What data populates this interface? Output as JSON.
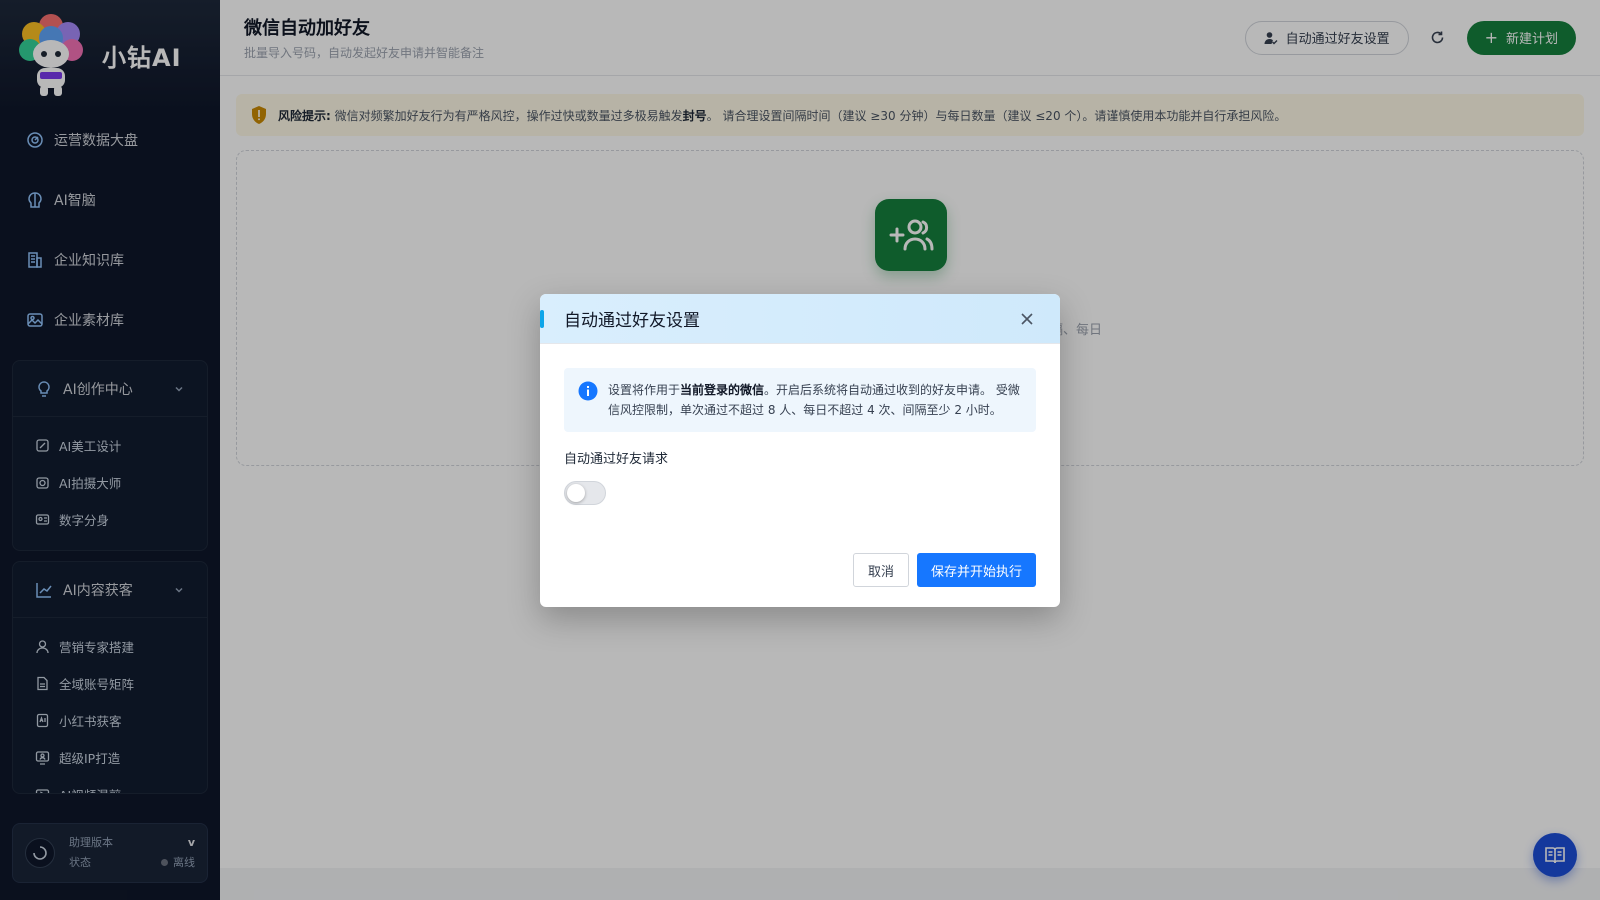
{
  "brand": {
    "name": "小钻AI",
    "logo_text": "小钻AI"
  },
  "sidebar": {
    "items": [
      {
        "label": "运营数据大盘",
        "icon": "dashboard-icon"
      },
      {
        "label": "AI智脑",
        "icon": "brain-icon"
      },
      {
        "label": "企业知识库",
        "icon": "building-icon"
      },
      {
        "label": "企业素材库",
        "icon": "image-icon"
      }
    ],
    "groups": [
      {
        "label": "AI创作中心",
        "icon": "bulb-icon",
        "items": [
          {
            "label": "AI美工设计",
            "icon": "palette-icon"
          },
          {
            "label": "AI拍摄大师",
            "icon": "camera-icon"
          },
          {
            "label": "数字分身",
            "icon": "avatar-card-icon"
          }
        ]
      },
      {
        "label": "AI内容获客",
        "icon": "trend-icon",
        "items": [
          {
            "label": "营销专家搭建",
            "icon": "user-icon"
          },
          {
            "label": "全域账号矩阵",
            "icon": "document-icon"
          },
          {
            "label": "小红书获客",
            "icon": "ai-doc-icon"
          },
          {
            "label": "超级IP打造",
            "icon": "monitor-user-icon"
          },
          {
            "label": "AI视频混剪",
            "icon": "video-icon"
          }
        ]
      }
    ],
    "footer": {
      "label_version": "助理版本",
      "label_status": "状态",
      "version": "v",
      "status": "离线"
    }
  },
  "header": {
    "title": "微信自动加好友",
    "subtitle": "批量导入号码，自动发起好友申请并智能备注",
    "auto_accept_button": "自动通过好友设置",
    "new_plan_button": "新建计划"
  },
  "warning": {
    "label": "风险提示:",
    "text_prefix": "微信对频繁加好友行为有严格风控，操作过快或数量过多极易触发",
    "text_emphasis": "封号",
    "text_suffix": "。 请合理设置间隔时间（建议 ≥30 分钟）与每日数量（建议 ≤20 个）。请谨慎使用本功能并自行承担风险。"
  },
  "empty_state": {
    "hint_visible": "间隔、每日"
  },
  "modal": {
    "title": "自动通过好友设置",
    "notice_prefix": "设置将作用于",
    "notice_emphasis": "当前登录的微信",
    "notice_suffix": "。开启后系统将自动通过收到的好友申请。 受微信风控限制，单次通过不超过 8 人、每日不超过 4 次、间隔至少 2 小时。",
    "field_label": "自动通过好友请求",
    "toggle_on": false,
    "cancel_label": "取消",
    "save_label": "保存并开始执行"
  },
  "colors": {
    "sidebar_bg": "#0f172a",
    "primary_green": "#15803d",
    "primary_blue": "#1677ff",
    "warning_bg": "#fef9e7"
  }
}
